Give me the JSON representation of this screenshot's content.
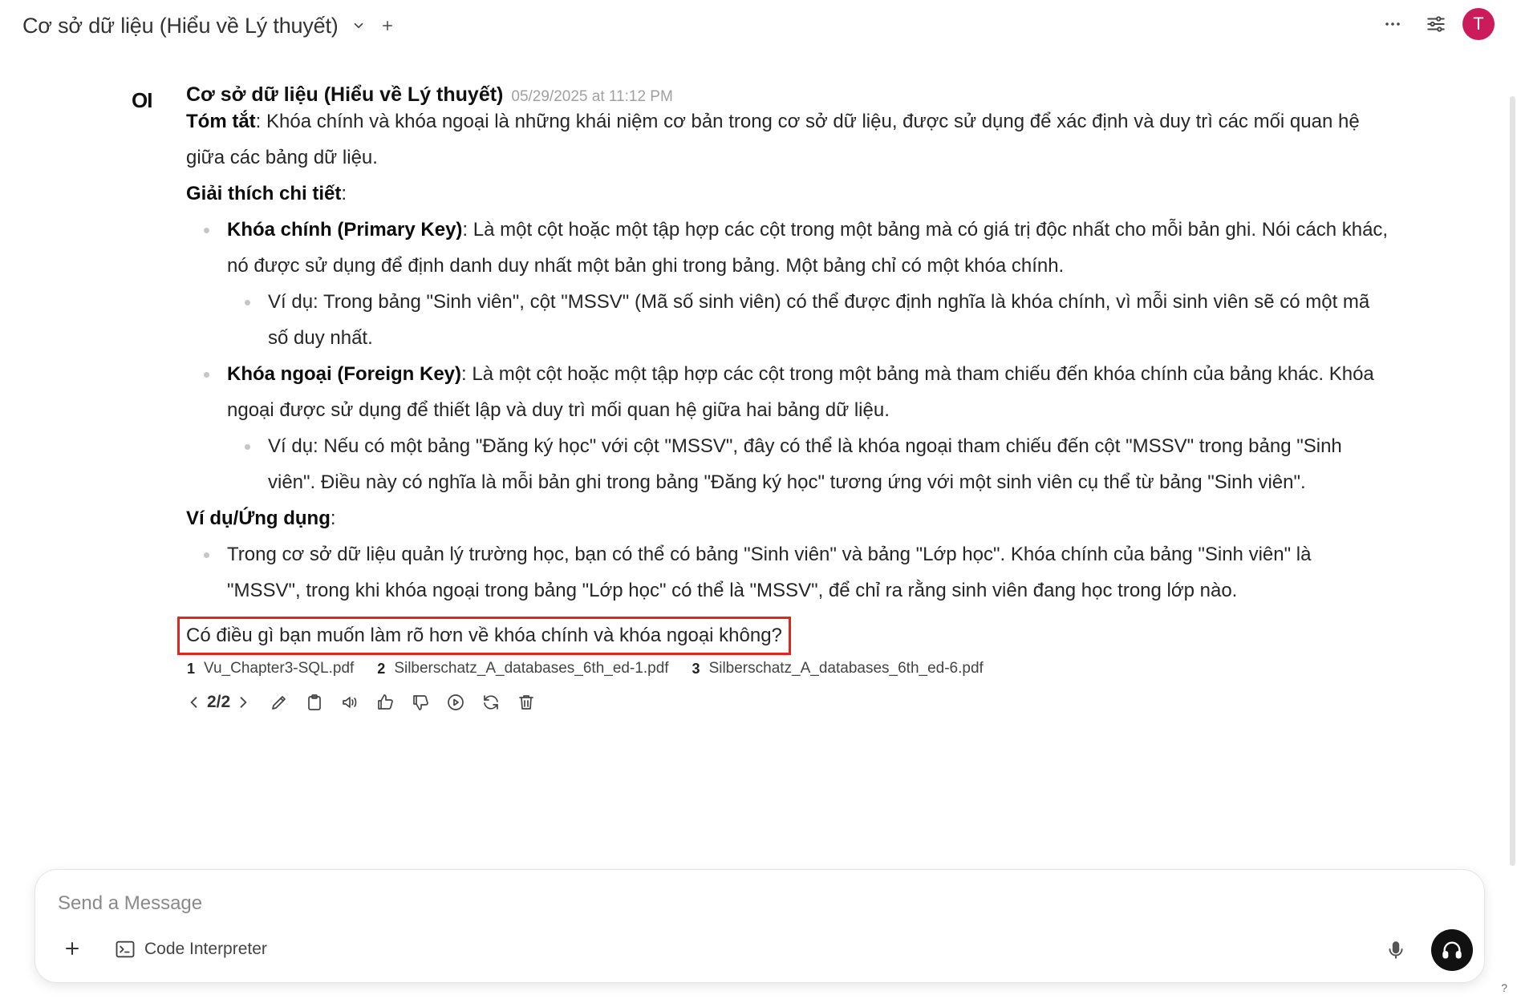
{
  "header": {
    "title": "Cơ sở dữ liệu (Hiểu về Lý thuyết)",
    "avatar_initial": "T"
  },
  "message": {
    "logo": "OI",
    "model_name": "Cơ sở dữ liệu (Hiểu về Lý thuyết)",
    "timestamp": "05/29/2025 at 11:12 PM",
    "summary_label": "Tóm tắt",
    "summary_text": ": Khóa chính và khóa ngoại là những khái niệm cơ bản trong cơ sở dữ liệu, được sử dụng để xác định và duy trì các mối quan hệ giữa các bảng dữ liệu.",
    "details_label": "Giải thích chi tiết",
    "colon": ":",
    "pk_label": "Khóa chính (Primary Key)",
    "pk_text": ": Là một cột hoặc một tập hợp các cột trong một bảng mà có giá trị độc nhất cho mỗi bản ghi. Nói cách khác, nó được sử dụng để định danh duy nhất một bản ghi trong bảng. Một bảng chỉ có một khóa chính.",
    "pk_example": "Ví dụ: Trong bảng \"Sinh viên\", cột \"MSSV\" (Mã số sinh viên) có thể được định nghĩa là khóa chính, vì mỗi sinh viên sẽ có một mã số duy nhất.",
    "fk_label": "Khóa ngoại (Foreign Key)",
    "fk_text": ": Là một cột hoặc một tập hợp các cột trong một bảng mà tham chiếu đến khóa chính của bảng khác. Khóa ngoại được sử dụng để thiết lập và duy trì mối quan hệ giữa hai bảng dữ liệu.",
    "fk_example": "Ví dụ: Nếu có một bảng \"Đăng ký học\" với cột \"MSSV\", đây có thể là khóa ngoại tham chiếu đến cột \"MSSV\" trong bảng \"Sinh viên\". Điều này có nghĩa là mỗi bản ghi trong bảng \"Đăng ký học\" tương ứng với một sinh viên cụ thể từ bảng \"Sinh viên\".",
    "examples_label": "Ví dụ/Ứng dụng",
    "app_text": "Trong cơ sở dữ liệu quản lý trường học, bạn có thể có bảng \"Sinh viên\" và bảng \"Lớp học\". Khóa chính của bảng \"Sinh viên\" là \"MSSV\", trong khi khóa ngoại trong bảng \"Lớp học\" có thể là \"MSSV\", để chỉ ra rằng sinh viên đang học trong lớp nào.",
    "followup": "Có điều gì bạn muốn làm rõ hơn về khóa chính và khóa ngoại không?",
    "citations": [
      {
        "num": "1",
        "name": "Vu_Chapter3-SQL.pdf"
      },
      {
        "num": "2",
        "name": "Silberschatz_A_databases_6th_ed-1.pdf"
      },
      {
        "num": "3",
        "name": "Silberschatz_A_databases_6th_ed-6.pdf"
      }
    ],
    "pager": "2/2"
  },
  "composer": {
    "placeholder": "Send a Message",
    "tool_label": "Code Interpreter"
  },
  "help": "?"
}
